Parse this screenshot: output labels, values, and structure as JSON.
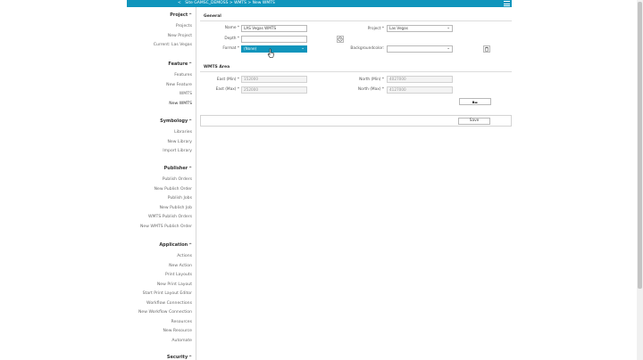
{
  "topbar": {
    "back_glyph": "<",
    "breadcrumb": "Site GAMSC_DEMOSS > WMTS > New WMTS",
    "menu_icon": "hamburger-icon",
    "color": "#0f95bc"
  },
  "sidebar": {
    "groups": [
      {
        "title": "Project",
        "chevron": "^",
        "items": [
          "Projects",
          "New Project",
          "Current: Las Vegas"
        ]
      },
      {
        "title": "Feature",
        "chevron": "^",
        "items": [
          "Features",
          "New Feature",
          "WMTS",
          "New WMTS"
        ]
      },
      {
        "title": "Symbology",
        "chevron": "^",
        "items": [
          "Libraries",
          "New Library",
          "Import Library"
        ]
      },
      {
        "title": "Publisher",
        "chevron": "^",
        "items": [
          "Publish Orders",
          "New Publish Order",
          "Publish Jobs",
          "New Publish Job",
          "WMTS Publish Orders",
          "New WMTS Publish Order"
        ]
      },
      {
        "title": "Application",
        "chevron": "^",
        "items": [
          "Actions",
          "New Action",
          "Print Layouts",
          "New Print Layout",
          "Start Print Layout Editor",
          "Workflow Connections",
          "New Workflow Connection",
          "Resources",
          "New Resource",
          "Automate"
        ]
      },
      {
        "title": "Security",
        "chevron": "^",
        "items": []
      }
    ],
    "active_item": "New WMTS"
  },
  "general": {
    "title": "General",
    "name_label": "Name *",
    "name_value": "LAS Vegas WMTS",
    "depth_label": "Depth *",
    "depth_value": "",
    "format_label": "Format *",
    "format_value": "(None)",
    "project_label": "Project *",
    "project_value": "Las Vegas",
    "background_label": "Backgroundcolor:",
    "background_value": "",
    "clock_icon": "clock-icon",
    "trash_icon": "trash-icon"
  },
  "area": {
    "title": "WMTS Area",
    "east_min_label": "East (Min) *",
    "east_min_value": "152000",
    "east_max_label": "East (Max) *",
    "east_max_value": "252000",
    "north_min_label": "North (Min) *",
    "north_min_value": "4027000",
    "north_max_label": "North (Max) *",
    "north_max_value": "4127000",
    "area_button_icon": "map-area-icon"
  },
  "footer": {
    "save_label": "Save"
  }
}
